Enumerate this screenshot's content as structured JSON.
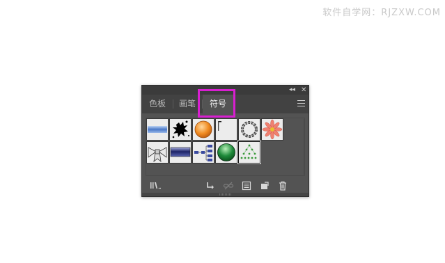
{
  "watermark": "软件自学网：RJZXW.COM",
  "panel": {
    "collapse_icon": "double-chevron-left-icon",
    "close_icon": "close-icon",
    "tabs": [
      {
        "label": "色板",
        "active": false
      },
      {
        "label": "画笔",
        "active": false
      },
      {
        "label": "符号",
        "active": true
      }
    ],
    "menu_icon": "hamburger-menu-icon",
    "symbols": [
      {
        "name": "blue-banner-symbol"
      },
      {
        "name": "ink-splat-symbol"
      },
      {
        "name": "orange-ball-symbol"
      },
      {
        "name": "corner-mark-symbol"
      },
      {
        "name": "chain-wreath-symbol"
      },
      {
        "name": "flower-symbol"
      },
      {
        "name": "ribbon-bow-symbol"
      },
      {
        "name": "dark-blue-button-symbol"
      },
      {
        "name": "org-chart-symbol"
      },
      {
        "name": "green-ball-symbol"
      },
      {
        "name": "dot-tree-symbol",
        "selected": true
      }
    ],
    "bottom_icons": [
      "symbol-library-menu-icon",
      "place-symbol-instance-icon",
      "break-link-icon",
      "symbol-options-icon",
      "new-symbol-icon",
      "delete-symbol-icon"
    ],
    "highlight_color": "#d81fd0"
  }
}
